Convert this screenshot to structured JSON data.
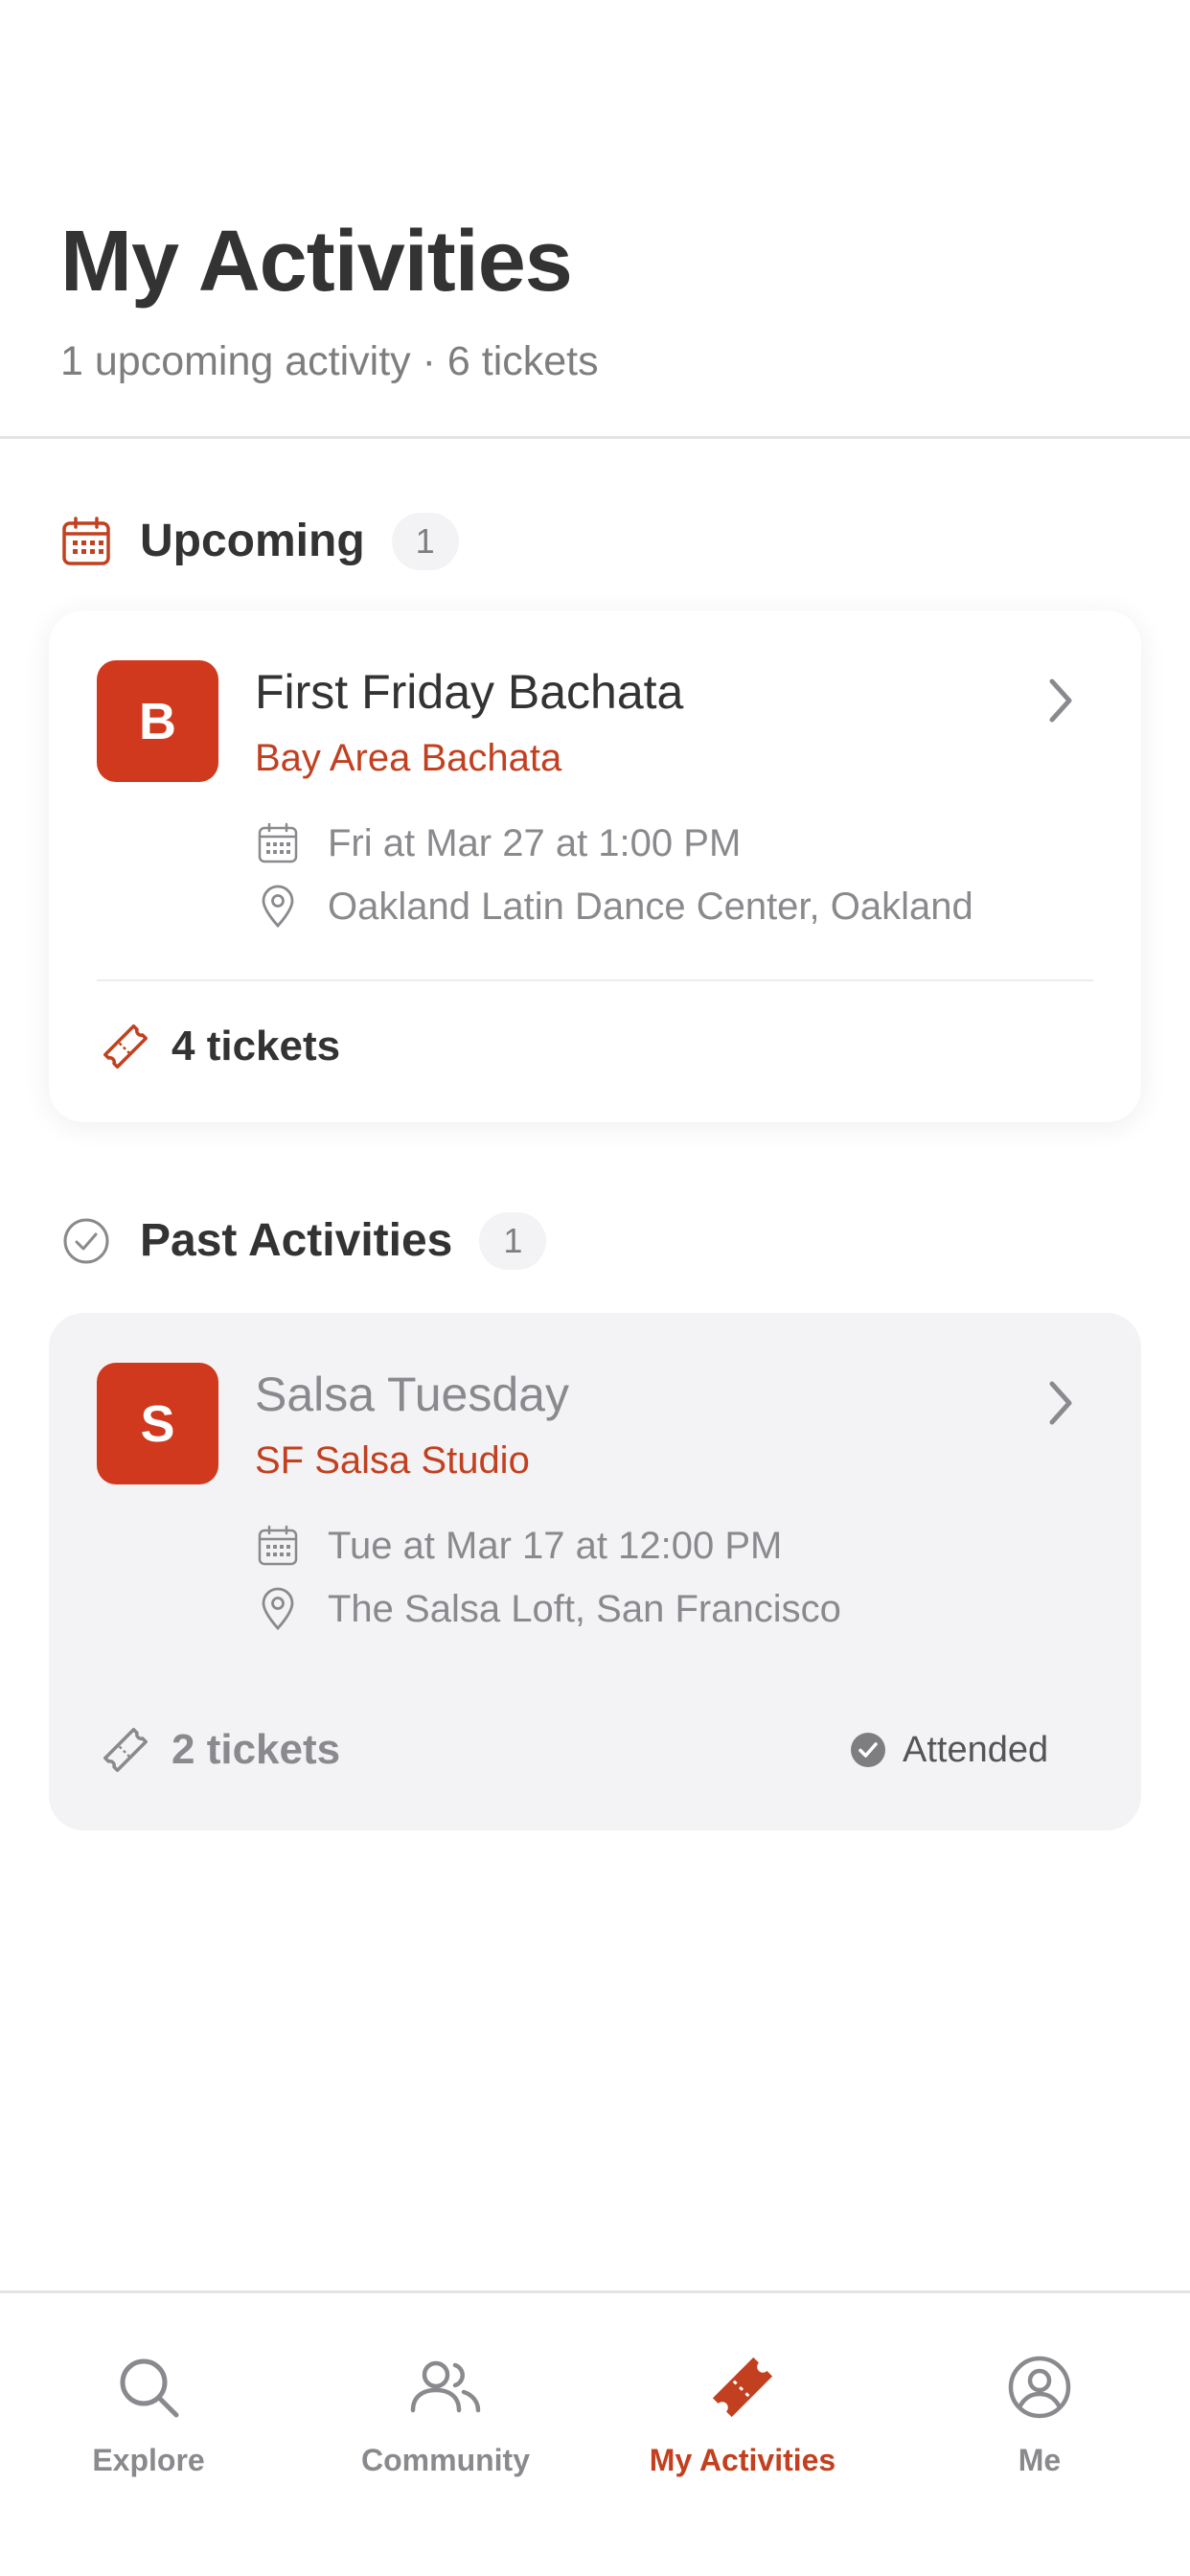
{
  "header": {
    "title": "My Activities",
    "subtitle": "1 upcoming activity · 6 tickets"
  },
  "sections": {
    "upcoming": {
      "title": "Upcoming",
      "count": "1",
      "icon": "calendar-icon",
      "event": {
        "avatar_letter": "B",
        "title": "First Friday Bachata",
        "organizer": "Bay Area Bachata",
        "date": "Fri at Mar 27 at 1:00 PM",
        "location": "Oakland Latin Dance Center, Oakland",
        "tickets": "4 tickets"
      }
    },
    "past": {
      "title": "Past Activities",
      "count": "1",
      "icon": "check-circle-icon",
      "event": {
        "avatar_letter": "S",
        "title": "Salsa Tuesday",
        "organizer": "SF Salsa Studio",
        "date": "Tue at Mar 17 at 12:00 PM",
        "location": "The Salsa Loft, San Francisco",
        "tickets": "2 tickets",
        "status": "Attended"
      }
    }
  },
  "tabbar": {
    "tabs": [
      {
        "label": "Explore",
        "icon": "search-icon",
        "active": false
      },
      {
        "label": "Community",
        "icon": "people-icon",
        "active": false
      },
      {
        "label": "My Activities",
        "icon": "ticket-icon",
        "active": true
      },
      {
        "label": "Me",
        "icon": "profile-icon",
        "active": false
      }
    ]
  },
  "colors": {
    "accent": "#c2401f",
    "avatar_bg": "#d0391e",
    "text_primary": "#333333",
    "text_secondary": "#8a8a8e",
    "past_card_bg": "#f3f3f5"
  }
}
